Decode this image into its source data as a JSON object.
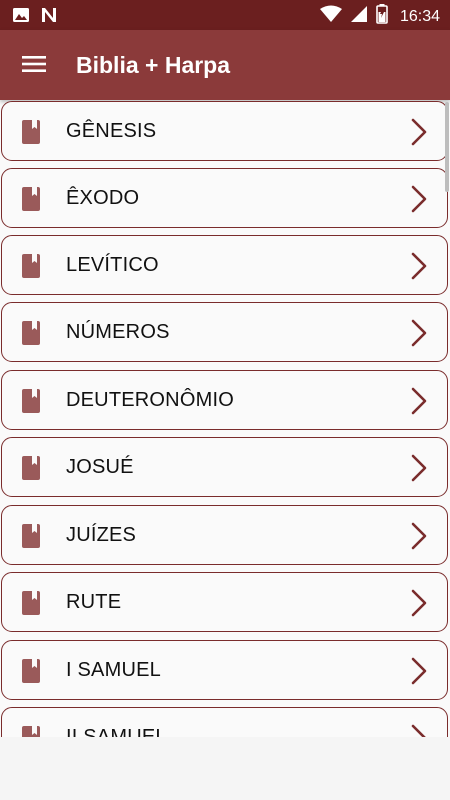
{
  "status_bar": {
    "time": "16:34",
    "left_icons": [
      "image-icon",
      "n-app-icon"
    ],
    "right_icons": [
      "wifi-icon",
      "signal-icon",
      "battery-icon"
    ]
  },
  "app_bar": {
    "title": "Biblia + Harpa",
    "menu_icon": "hamburger-menu-icon"
  },
  "books": [
    {
      "name": "GÊNESIS"
    },
    {
      "name": "ÊXODO"
    },
    {
      "name": "LEVÍTICO"
    },
    {
      "name": "NÚMEROS"
    },
    {
      "name": "DEUTERONÔMIO"
    },
    {
      "name": "JOSUÉ"
    },
    {
      "name": "JUÍZES"
    },
    {
      "name": "RUTE"
    },
    {
      "name": "I SAMUEL"
    },
    {
      "name": "II SAMUEL"
    }
  ],
  "colors": {
    "status_bar": "#6b1f1f",
    "app_bar": "#8b3a3a",
    "item_border": "#7a2c2c",
    "book_icon": "#9a5a5a",
    "chevron": "#7a2c2c"
  }
}
